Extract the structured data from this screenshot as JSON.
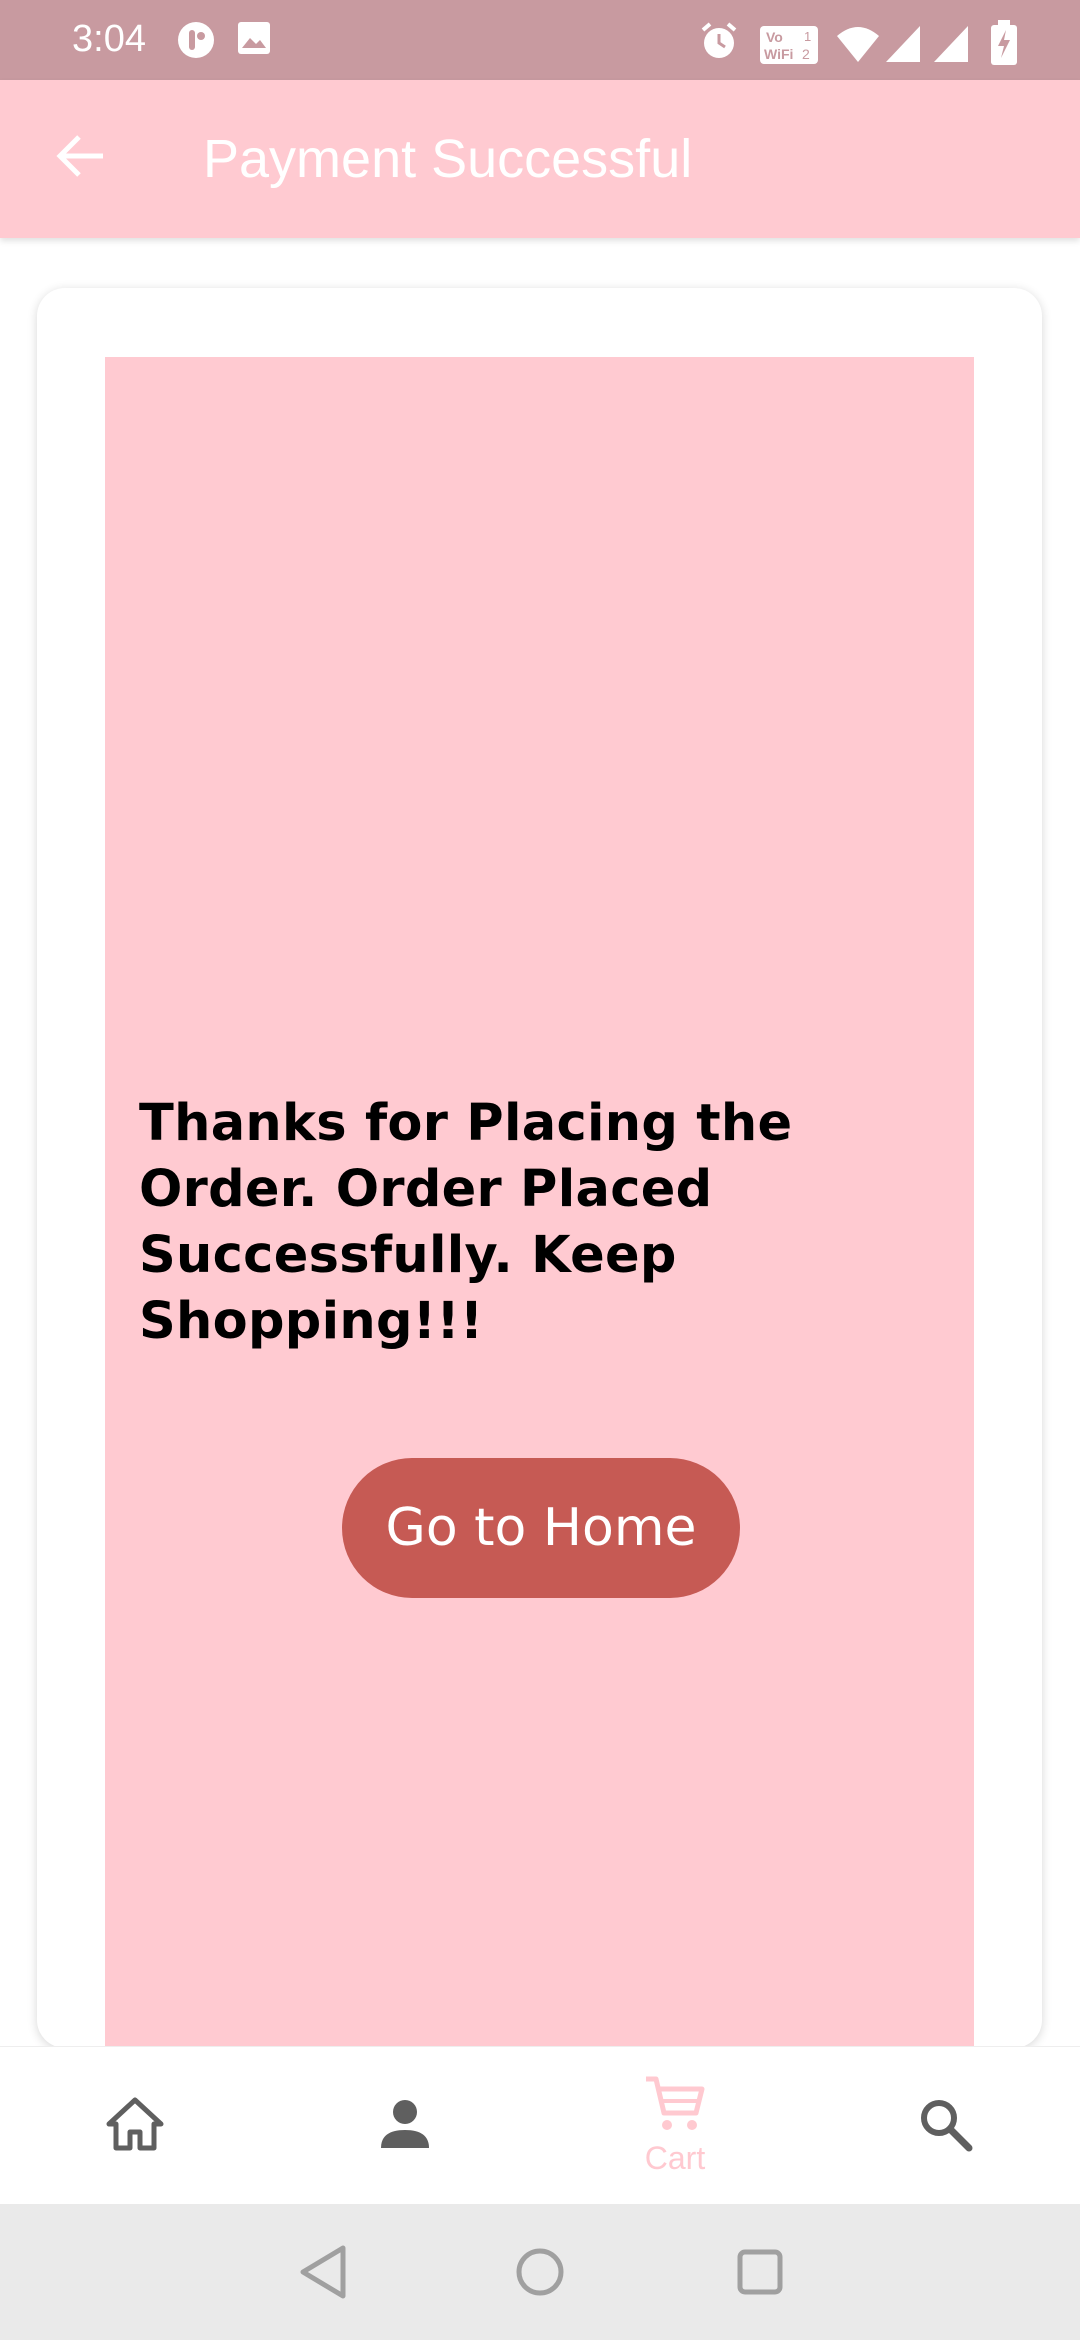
{
  "status_bar": {
    "time": "3:04",
    "left_icons": [
      "app-notification-icon",
      "image-notification-icon"
    ],
    "right_icons": [
      "alarm-icon",
      "vowifi-icon",
      "wifi-icon",
      "signal-icon",
      "signal-icon",
      "battery-charging-icon"
    ],
    "vowifi_label": "Vo WiFi"
  },
  "app_bar": {
    "title": "Payment Successful",
    "back_icon": "back-arrow-icon",
    "background": "#ffcad1"
  },
  "content": {
    "message": "Thanks for Placing the Order. Order Placed Successfully. Keep Shopping!!!",
    "button_label": "Go to Home",
    "panel_color": "#ffcad1",
    "button_color": "#c65a54"
  },
  "bottom_nav": {
    "items": [
      {
        "icon": "home-icon",
        "label": ""
      },
      {
        "icon": "person-icon",
        "label": ""
      },
      {
        "icon": "cart-icon",
        "label": "Cart",
        "active": true
      },
      {
        "icon": "search-icon",
        "label": ""
      }
    ]
  },
  "system_nav": {
    "buttons": [
      "back-triangle-icon",
      "home-circle-icon",
      "recents-square-icon"
    ]
  }
}
